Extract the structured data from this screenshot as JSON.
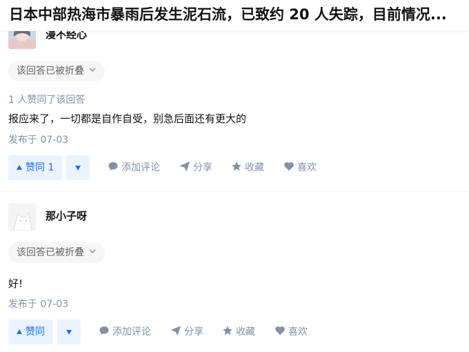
{
  "question": {
    "title": "日本中部热海市暴雨后发生泥石流，已致约 20 人失踪，目前情况..."
  },
  "answers": [
    {
      "author": "漫不经心",
      "collapsed_label": "该回答已被折叠",
      "likers_text": "1 人赞同了该回答",
      "content": "报应来了，一切都是自作自受，别急后面还有更大的",
      "published": "发布于 07-03",
      "vote_up_label": "赞同 1",
      "actions": {
        "comment": "添加评论",
        "share": "分享",
        "collect": "收藏",
        "like": "喜欢"
      }
    },
    {
      "author": "那小子呀",
      "collapsed_label": "该回答已被折叠",
      "content": "好!",
      "published": "发布于 07-03",
      "vote_up_label": "赞同",
      "actions": {
        "comment": "添加评论",
        "share": "分享",
        "collect": "收藏",
        "like": "喜欢"
      }
    }
  ],
  "colors": {
    "accent": "#1772f6",
    "accent_bg": "#eaf3ff",
    "muted": "#8590a6"
  },
  "icons": {
    "vote_up": "triangle-up-icon",
    "vote_down": "triangle-down-icon",
    "comment": "speech-bubble-icon",
    "share": "paper-plane-icon",
    "collect": "star-icon",
    "like": "heart-icon",
    "collapse": "chevron-down-icon"
  }
}
